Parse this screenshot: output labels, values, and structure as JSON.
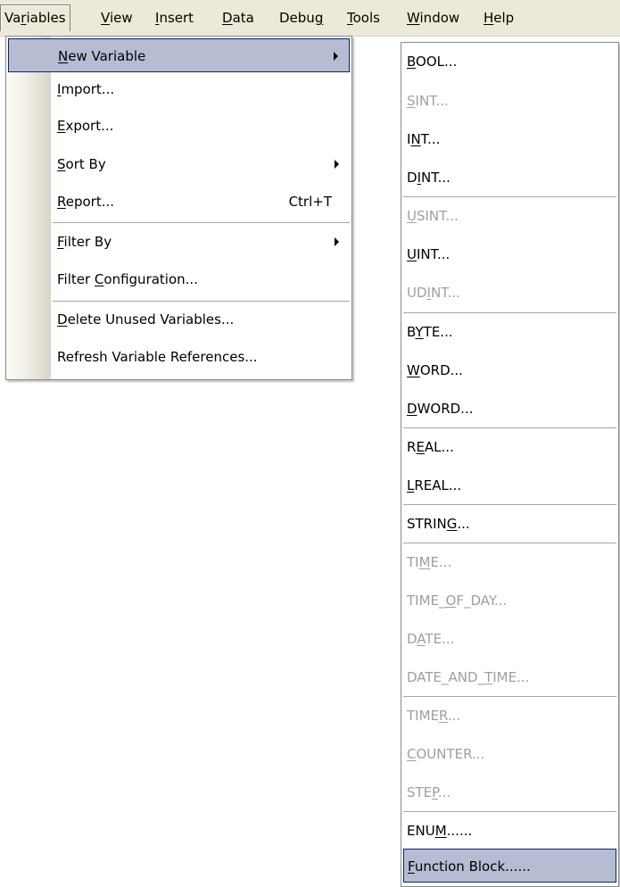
{
  "menubar": {
    "items": [
      {
        "pre": "Va",
        "key": "r",
        "post": "iables"
      },
      {
        "pre": "",
        "key": "V",
        "post": "iew"
      },
      {
        "pre": "",
        "key": "I",
        "post": "nsert"
      },
      {
        "pre": "",
        "key": "D",
        "post": "ata"
      },
      {
        "pre": "Debu",
        "key": "g",
        "post": ""
      },
      {
        "pre": "",
        "key": "T",
        "post": "ools"
      },
      {
        "pre": "",
        "key": "W",
        "post": "indow"
      },
      {
        "pre": "",
        "key": "H",
        "post": "elp"
      }
    ]
  },
  "main_menu": {
    "items": [
      {
        "pre": "",
        "key": "N",
        "post": "ew Variable"
      },
      {
        "pre": "",
        "key": "I",
        "post": "mport..."
      },
      {
        "pre": "",
        "key": "E",
        "post": "xport..."
      },
      {
        "pre": "",
        "key": "S",
        "post": "ort By"
      },
      {
        "pre": "",
        "key": "R",
        "post": "eport...",
        "shortcut": "Ctrl+T"
      },
      {
        "pre": "",
        "key": "F",
        "post": "ilter By"
      },
      {
        "pre": "Filter ",
        "key": "C",
        "post": "onfiguration..."
      },
      {
        "pre": "",
        "key": "D",
        "post": "elete Unused Variables..."
      },
      {
        "pre": "Refresh Variable References...",
        "key": "",
        "post": ""
      }
    ]
  },
  "sub_menu": {
    "items": [
      {
        "pre": "",
        "key": "B",
        "post": "OOL..."
      },
      {
        "pre": "",
        "key": "S",
        "post": "INT..."
      },
      {
        "pre": "I",
        "key": "N",
        "post": "T..."
      },
      {
        "pre": "D",
        "key": "I",
        "post": "NT..."
      },
      {
        "pre": "",
        "key": "U",
        "post": "SINT..."
      },
      {
        "pre": "",
        "key": "U",
        "post": "INT..."
      },
      {
        "pre": "UD",
        "key": "I",
        "post": "NT..."
      },
      {
        "pre": "B",
        "key": "Y",
        "post": "TE..."
      },
      {
        "pre": "",
        "key": "W",
        "post": "ORD..."
      },
      {
        "pre": "",
        "key": "D",
        "post": "WORD..."
      },
      {
        "pre": "R",
        "key": "E",
        "post": "AL..."
      },
      {
        "pre": "",
        "key": "L",
        "post": "REAL..."
      },
      {
        "pre": "STRIN",
        "key": "G",
        "post": "..."
      },
      {
        "pre": "TI",
        "key": "M",
        "post": "E..."
      },
      {
        "pre": "TIME_",
        "key": "O",
        "post": "F_DAY..."
      },
      {
        "pre": "D",
        "key": "A",
        "post": "TE..."
      },
      {
        "pre": "DATE_AND_",
        "key": "T",
        "post": "IME..."
      },
      {
        "pre": "TIME",
        "key": "R",
        "post": "..."
      },
      {
        "pre": "",
        "key": "C",
        "post": "OUNTER..."
      },
      {
        "pre": "STE",
        "key": "P",
        "post": "..."
      },
      {
        "pre": "ENU",
        "key": "M",
        "post": "......"
      },
      {
        "pre": "",
        "key": "F",
        "post": "unction Block......"
      }
    ]
  }
}
